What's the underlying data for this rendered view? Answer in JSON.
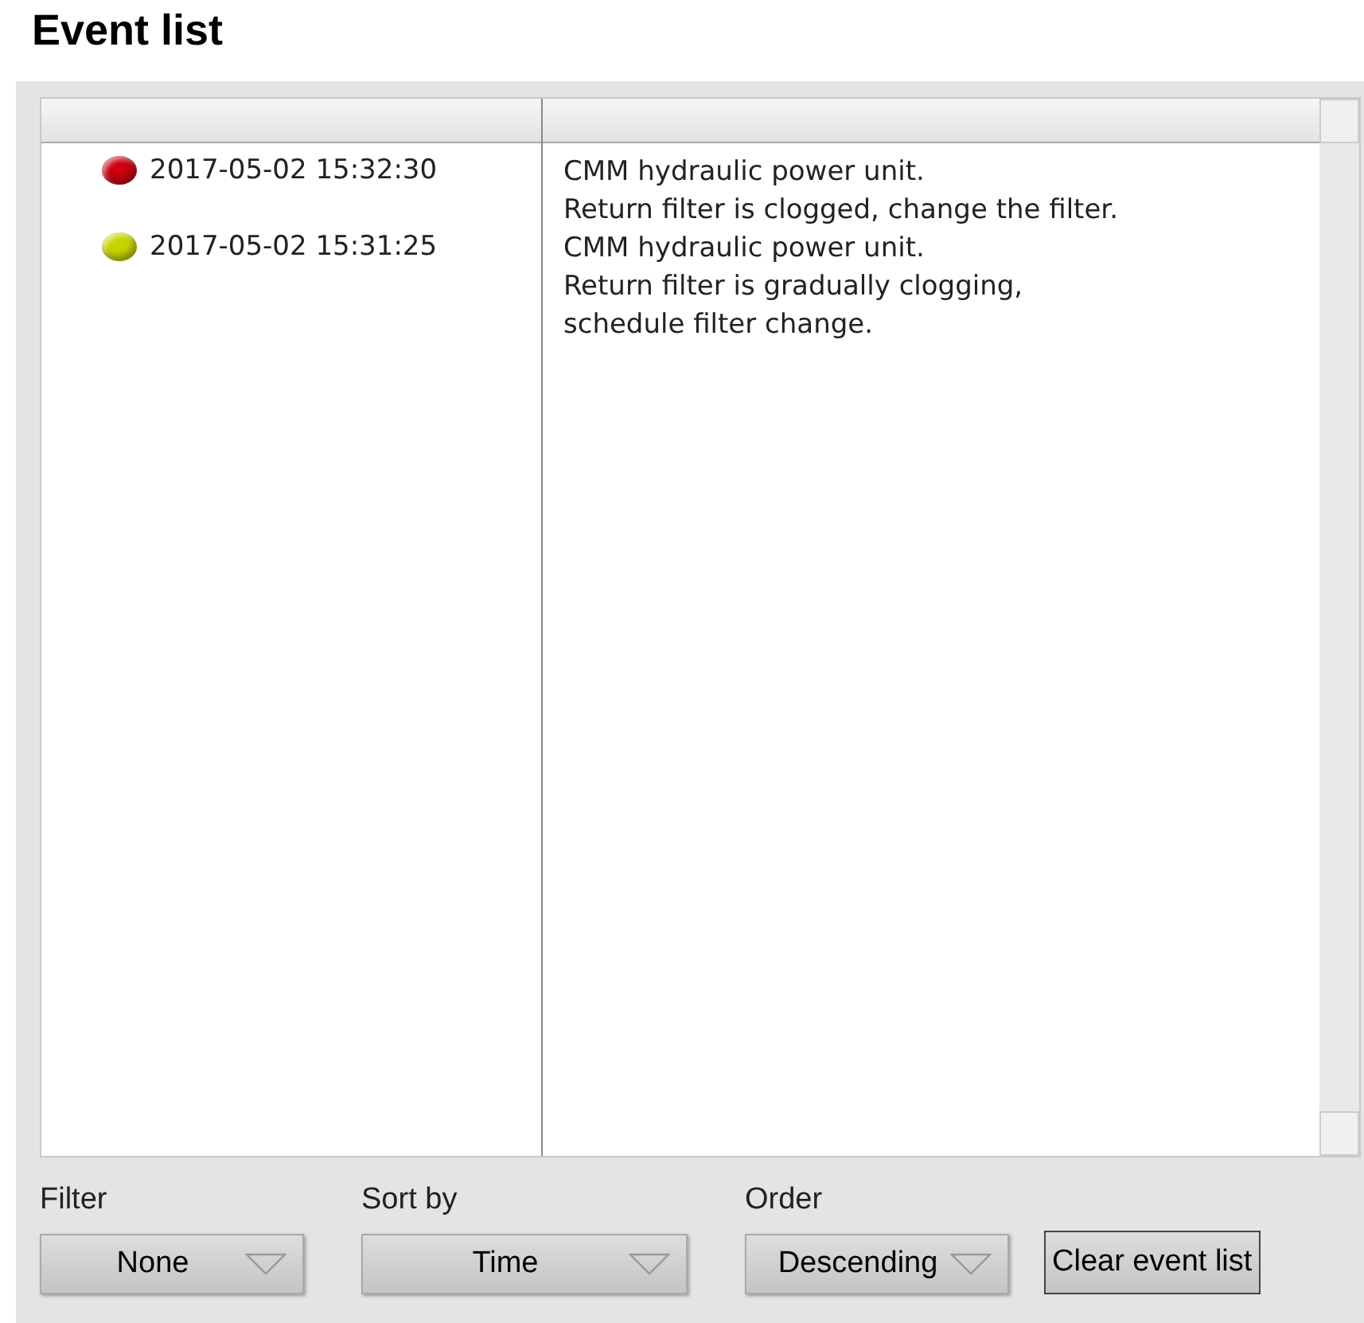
{
  "title": "Event list",
  "events": [
    {
      "time": "2017-05-02 15:32:30",
      "color": "#cc0011",
      "message": "CMM hydraulic power unit.\nReturn filter is clogged, change the filter."
    },
    {
      "time": "2017-05-02 15:31:25",
      "color": "#c8d400",
      "message": "CMM hydraulic power unit.\nReturn filter is gradually clogging,\nschedule filter change."
    }
  ],
  "controls": [
    {
      "label": "Filter",
      "value": "None",
      "kind": "small"
    },
    {
      "label": "Sort by",
      "value": "Time",
      "kind": "medium"
    },
    {
      "label": "Order",
      "value": "Descending",
      "kind": "small"
    }
  ],
  "button": "Clear event list"
}
